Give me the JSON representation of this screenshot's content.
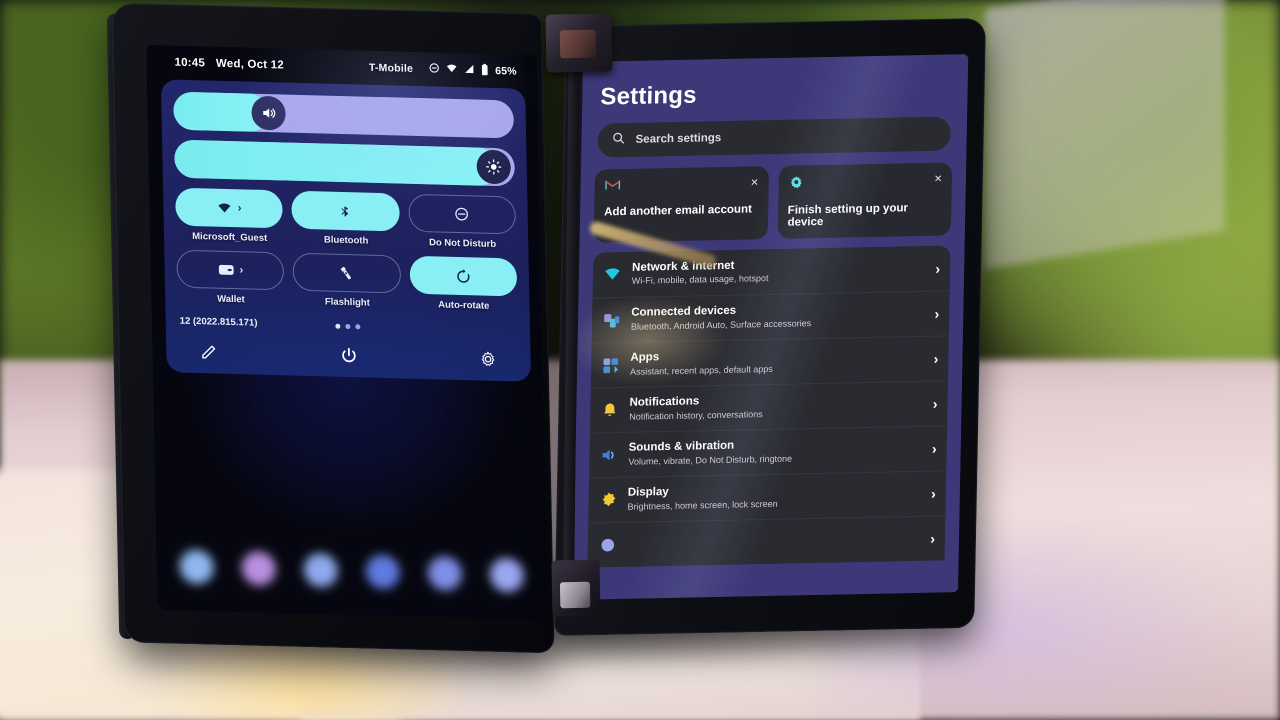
{
  "scene": {
    "description": "Photo of a dual-screen foldable phone on a retail display pedestal",
    "background_colors": {
      "foliage": "#3d5a20",
      "podium": "#f0dede",
      "warm_glow": "#ffe196"
    }
  },
  "left_screen": {
    "status_bar": {
      "time": "10:45",
      "date": "Wed, Oct 12",
      "carrier": "T-Mobile",
      "icons": [
        "dnd-icon",
        "wifi-icon",
        "signal-icon",
        "battery-icon"
      ],
      "battery_percent": "65%"
    },
    "sliders": [
      {
        "name": "volume",
        "icon": "volume-icon",
        "value": 28
      },
      {
        "name": "brightness",
        "icon": "brightness-icon",
        "value": 95
      }
    ],
    "tiles": [
      {
        "label": "Microsoft_Guest",
        "icon": "wifi-icon",
        "state": "on",
        "expandable": true
      },
      {
        "label": "Bluetooth",
        "icon": "bluetooth-icon",
        "state": "on",
        "expandable": false
      },
      {
        "label": "Do Not Disturb",
        "icon": "do-not-disturb-icon",
        "state": "off",
        "expandable": false
      },
      {
        "label": "Wallet",
        "icon": "wallet-icon",
        "state": "off",
        "expandable": true
      },
      {
        "label": "Flashlight",
        "icon": "flashlight-icon",
        "state": "off",
        "expandable": false
      },
      {
        "label": "Auto-rotate",
        "icon": "auto-rotate-icon",
        "state": "on",
        "expandable": false
      }
    ],
    "build_version": "12 (2022.815.171)",
    "page_dots": {
      "count": 3,
      "active_index": 0
    },
    "actions": [
      {
        "name": "edit-tiles",
        "icon": "pencil-icon"
      },
      {
        "name": "power",
        "icon": "power-icon"
      },
      {
        "name": "settings",
        "icon": "gear-icon"
      }
    ],
    "accent_color": "#89eff5"
  },
  "right_screen": {
    "title": "Settings",
    "search": {
      "placeholder": "Search settings",
      "icon": "search-icon"
    },
    "suggestion_cards": [
      {
        "label": "Add another email account",
        "icon": "gmail-icon",
        "close": "×"
      },
      {
        "label": "Finish setting up your device",
        "icon": "gear-icon",
        "close": "×"
      }
    ],
    "list": [
      {
        "title": "Network & internet",
        "subtitle": "Wi-Fi, mobile, data usage, hotspot",
        "icon": "wifi-icon",
        "icon_color": "#20c7e0",
        "chevron": "›"
      },
      {
        "title": "Connected devices",
        "subtitle": "Bluetooth, Android Auto, Surface accessories",
        "icon": "devices-icon",
        "icon_color": "#6a7be0",
        "chevron": "›"
      },
      {
        "title": "Apps",
        "subtitle": "Assistant, recent apps, default apps",
        "icon": "apps-icon",
        "icon_color": "#5b8de8",
        "chevron": "›"
      },
      {
        "title": "Notifications",
        "subtitle": "Notification history, conversations",
        "icon": "bell-icon",
        "icon_color": "#f3c63d",
        "chevron": "›"
      },
      {
        "title": "Sounds & vibration",
        "subtitle": "Volume, vibrate, Do Not Disturb, ringtone",
        "icon": "speaker-icon",
        "icon_color": "#3e7fe0",
        "chevron": "›"
      },
      {
        "title": "Display",
        "subtitle": "Brightness, home screen, lock screen",
        "icon": "display-sun-icon",
        "icon_color": "#f2c83a",
        "chevron": "›"
      },
      {
        "title": "",
        "subtitle": "",
        "icon": "cut-off-icon",
        "icon_color": "#9aa4e8",
        "chevron": "›"
      }
    ],
    "background_color": "#3d3878",
    "row_color": "#2a2b31"
  }
}
